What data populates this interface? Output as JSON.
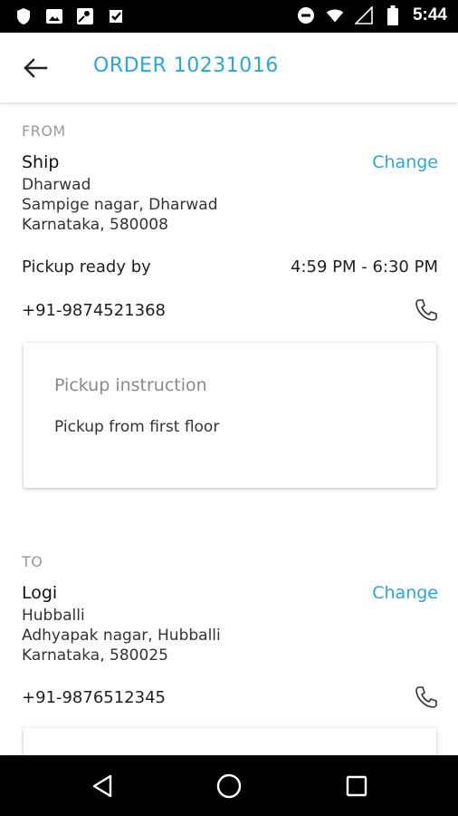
{
  "status_bar": {
    "time": "5:44",
    "left_icons": [
      "shield-icon",
      "image-icon",
      "map-pin-icon",
      "check-badge-icon"
    ],
    "right_icons": [
      "do-not-disturb-icon",
      "wifi-icon",
      "signal-icon",
      "battery-icon"
    ]
  },
  "app_bar": {
    "title": "ORDER 10231016",
    "back_icon": "arrow-left-icon"
  },
  "from": {
    "section_label": "FROM",
    "name": "Ship",
    "change_label": "Change",
    "address_line1": "Dharwad",
    "address_line2": "Sampige nagar, Dharwad",
    "address_line3": "Karnataka, 580008",
    "pickup_label": "Pickup ready by",
    "pickup_time": "4:59 PM - 6:30 PM",
    "phone": "+91-9874521368",
    "instruction_title": "Pickup instruction",
    "instruction_text": "Pickup from first floor"
  },
  "to": {
    "section_label": "TO",
    "name": "Logi",
    "change_label": "Change",
    "address_line1": "Hubballi",
    "address_line2": "Adhyapak nagar, Hubballi",
    "address_line3": "Karnataka, 580025",
    "phone": "+91-9876512345"
  },
  "nav_bar": {
    "icons": [
      "back-triangle-icon",
      "home-circle-icon",
      "recents-square-icon"
    ]
  },
  "colors": {
    "accent": "#2aa6d8",
    "status_bar": "#000000",
    "nav_bar": "#000000"
  }
}
